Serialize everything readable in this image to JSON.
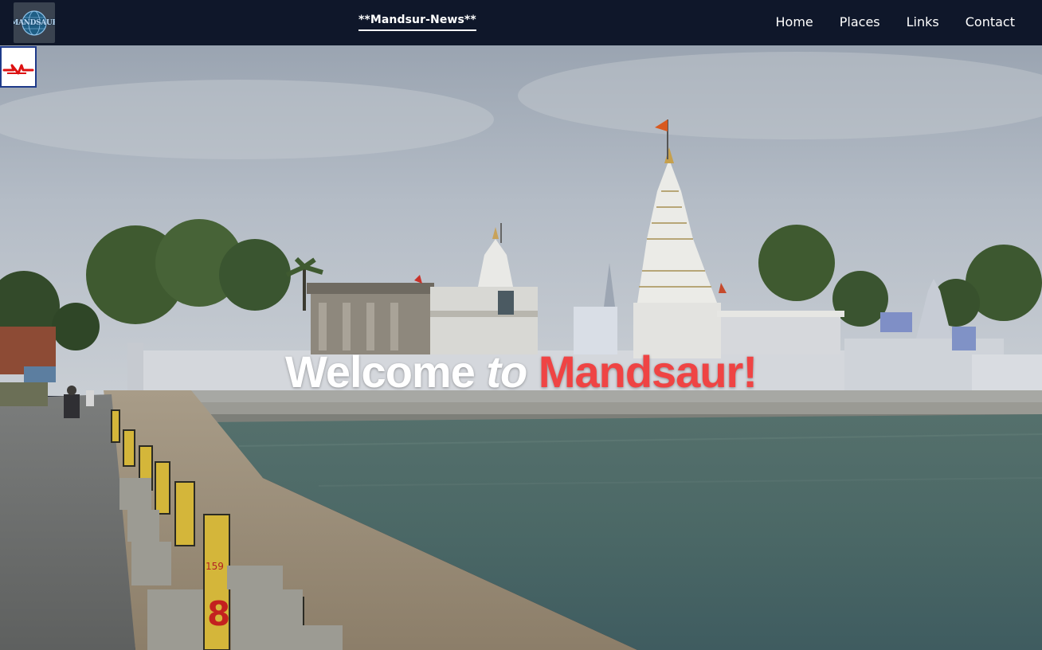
{
  "nav": {
    "logo_text": "MANDSAUR",
    "brand": "**Mandsur-News**",
    "links": [
      {
        "label": "Home"
      },
      {
        "label": "Places"
      },
      {
        "label": "Links"
      },
      {
        "label": "Contact"
      }
    ]
  },
  "hero": {
    "welcome_word": "Welcome",
    "to_word": "to",
    "city_word": "Mandsaur!",
    "accent_color": "#ef4444",
    "milestone_text": "159",
    "milestone_big": "8"
  },
  "colors": {
    "navbar_bg": "#0f172a",
    "nav_text": "#ffffff"
  }
}
